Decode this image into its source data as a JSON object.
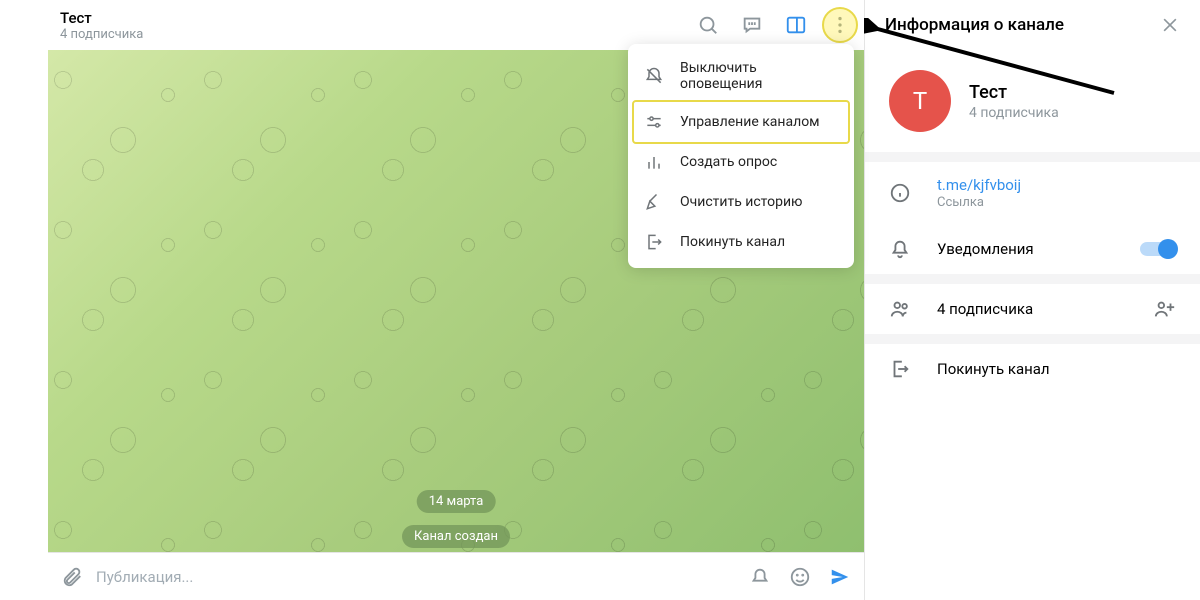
{
  "header": {
    "title": "Тест",
    "subtitle": "4 подписчика"
  },
  "dropdown": {
    "items": [
      {
        "label": "Выключить оповещения"
      },
      {
        "label": "Управление каналом"
      },
      {
        "label": "Создать опрос"
      },
      {
        "label": "Очистить историю"
      },
      {
        "label": "Покинуть канал"
      }
    ]
  },
  "chat": {
    "date_badge": "14 марта",
    "system_message": "Канал создан"
  },
  "input": {
    "placeholder": "Публикация..."
  },
  "side_panel": {
    "title": "Информация о канале",
    "avatar_letter": "Т",
    "name": "Тест",
    "subtitle": "4 подписчика",
    "link": "t.me/kjfvboij",
    "link_label": "Ссылка",
    "notifications": "Уведомления",
    "subscribers": "4 подписчика",
    "leave": "Покинуть канал"
  }
}
